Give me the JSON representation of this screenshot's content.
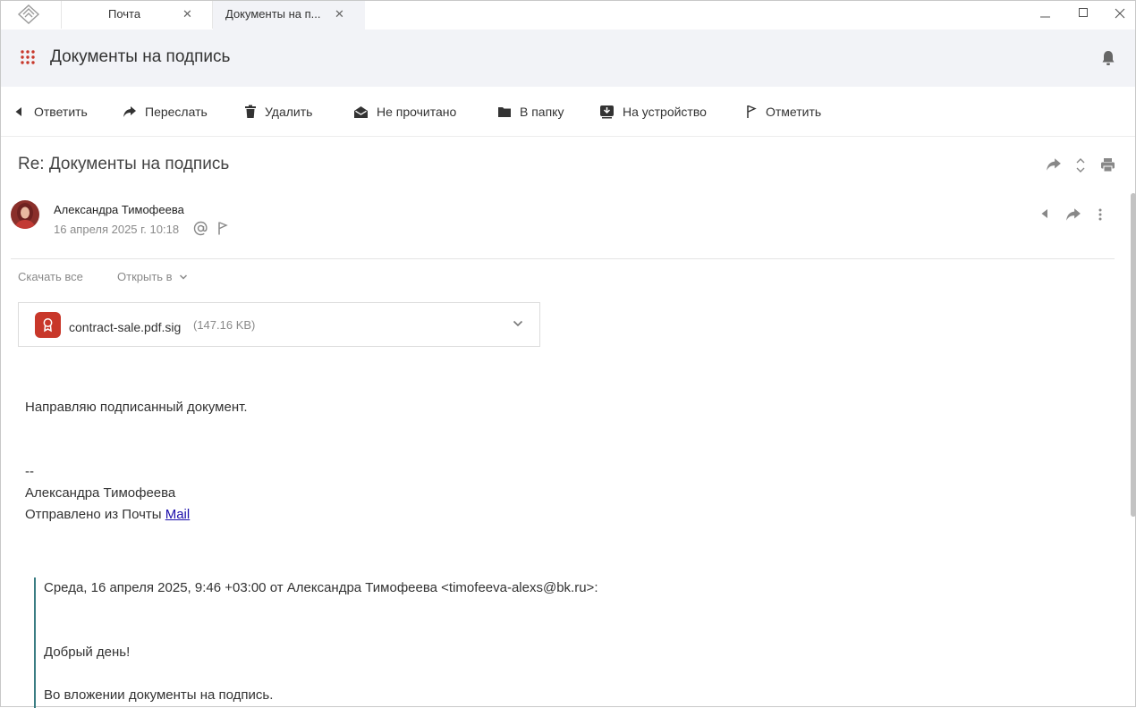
{
  "tabs": [
    {
      "label": "Почта"
    },
    {
      "label": "Документы на п..."
    }
  ],
  "header": {
    "title": "Документы на подпись"
  },
  "toolbar": {
    "reply": "Ответить",
    "forward": "Переслать",
    "delete": "Удалить",
    "unread": "Не прочитано",
    "to_folder": "В папку",
    "to_device": "На устройство",
    "flag": "Отметить"
  },
  "message": {
    "subject": "Re: Документы на подпись",
    "sender": "Александра Тимофеева",
    "date": "16 апреля 2025 г. 10:18",
    "download_all": "Скачать все",
    "open_in": "Открыть в",
    "attachment": {
      "name": "contract-sale.pdf.sig",
      "size": "(147.16 KB)"
    },
    "body": {
      "line1": "Направляю подписанный документ.",
      "sig_sep": "--",
      "sig_name": "Александра Тимофеева",
      "sent_from": "Отправлено из Почты ",
      "sent_link": "Mail"
    },
    "quote": {
      "header": "Среда, 16 апреля 2025, 9:46 +03:00 от Александра Тимофеева <timofeeva-alexs@bk.ru>:",
      "greeting": "Добрый день!",
      "line": "Во вложении документы на подпись."
    }
  },
  "colors": {
    "accent": "#3a7d83",
    "attachment_icon": "#c8372a",
    "header_bg": "#f2f3f7"
  }
}
